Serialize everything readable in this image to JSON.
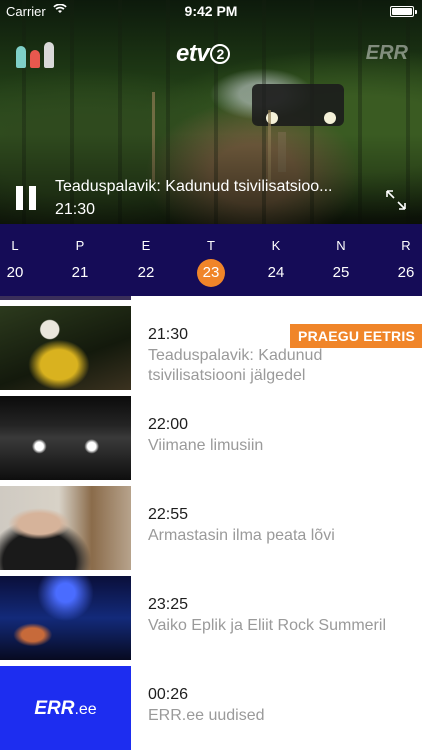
{
  "status_bar": {
    "carrier": "Carrier",
    "time": "9:42 PM"
  },
  "player": {
    "channel_logo": "etv",
    "channel_number": "2",
    "watermark": "ERR",
    "now_title": "Teaduspalavik: Kadunud tsivilisatsioo...",
    "now_time": "21:30",
    "state": "playing"
  },
  "days": [
    {
      "weekday": "L",
      "date": "20"
    },
    {
      "weekday": "P",
      "date": "21"
    },
    {
      "weekday": "E",
      "date": "22"
    },
    {
      "weekday": "T",
      "date": "23",
      "selected": true
    },
    {
      "weekday": "K",
      "date": "24"
    },
    {
      "weekday": "N",
      "date": "25"
    },
    {
      "weekday": "R",
      "date": "26"
    }
  ],
  "schedule": [
    {
      "time": "21:30",
      "title": "Teaduspalavik: Kadunud tsivilisatsiooni jälgedel",
      "badge": "PRAEGU EETRIS"
    },
    {
      "time": "22:00",
      "title": "Viimane limusiin"
    },
    {
      "time": "22:55",
      "title": "Armastasin ilma peata lõvi"
    },
    {
      "time": "23:25",
      "title": "Vaiko Eplik ja Eliit Rock Summeril"
    },
    {
      "time": "00:26",
      "title": "ERR.ee uudised",
      "thumb_logo": "ERR",
      "thumb_logo_suffix": ".ee"
    }
  ],
  "colors": {
    "accent": "#f08529",
    "day_bar": "#150c57",
    "err_blue": "#1d2df0"
  }
}
